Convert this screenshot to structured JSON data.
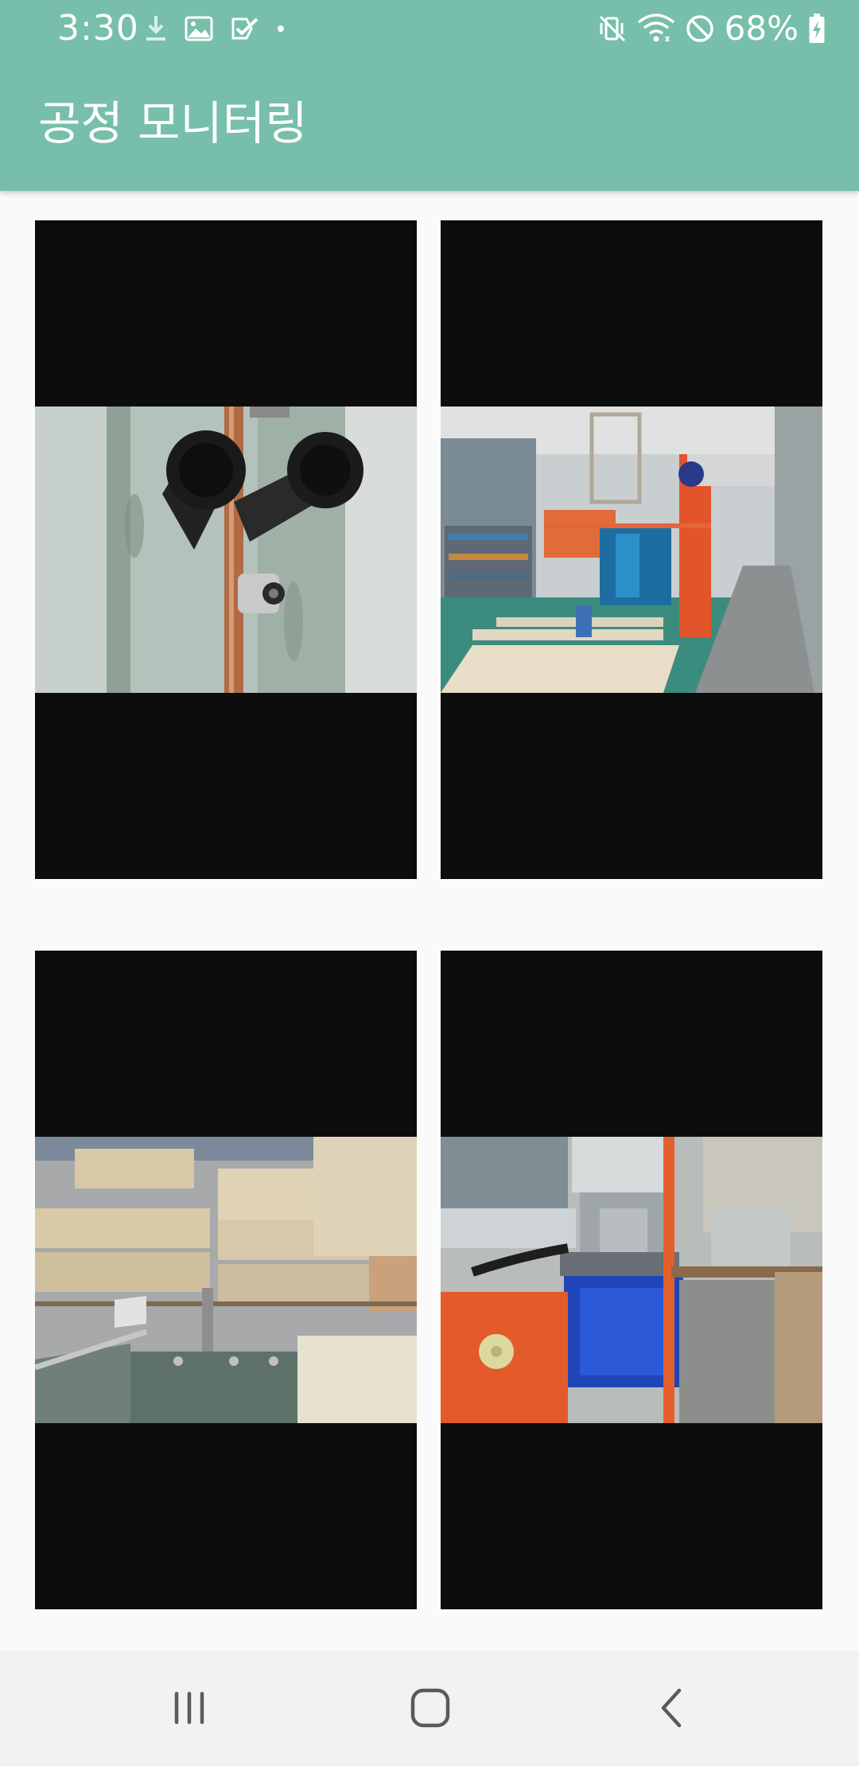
{
  "status_bar": {
    "time": "3:30",
    "battery": "68%",
    "left_icons": [
      "download-icon",
      "image-icon",
      "task-check-icon",
      "dot-icon"
    ],
    "right_icons": [
      "vibrate-mute-icon",
      "wifi-icon",
      "do-not-disturb-icon",
      "battery-icon"
    ]
  },
  "app_bar": {
    "title": "공정 모니터링",
    "color": "#77bfaa"
  },
  "cameras": [
    {
      "scene": "copper-pipe-closeup"
    },
    {
      "scene": "plating-line-overview"
    },
    {
      "scene": "warehouse-boxes-tank"
    },
    {
      "scene": "motor-gearbox-closeup"
    }
  ],
  "nav_bar": {
    "buttons": [
      "recent-apps-icon",
      "home-icon",
      "back-icon"
    ]
  }
}
